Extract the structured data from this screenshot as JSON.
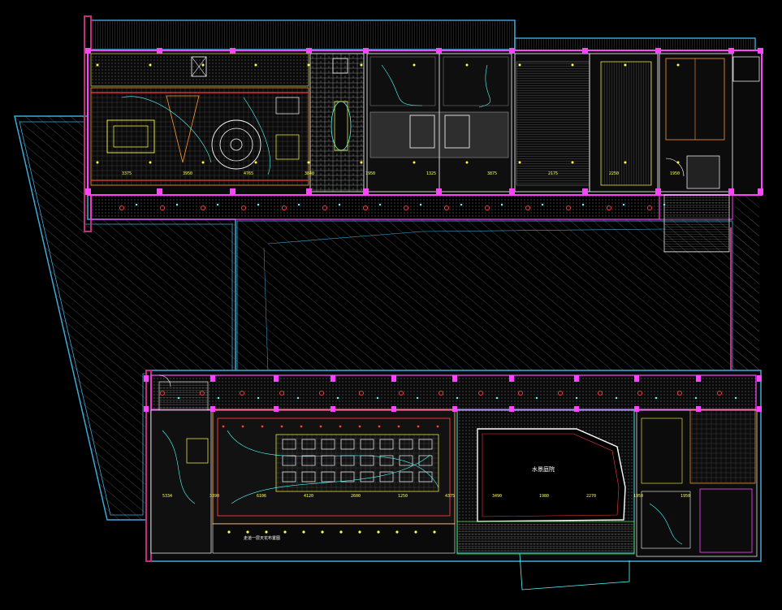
{
  "drawing": {
    "background": "#000000",
    "colors": {
      "facade": "#3fa9d9",
      "wall": "#ff44ff",
      "wall_dark": "#c0307a",
      "furniture": "#ffff44",
      "fixture": "#55ffff",
      "red": "#ff3b3b",
      "grid": "#5a5a5a",
      "white": "#ffffff",
      "green": "#44ff44",
      "orange": "#ff9a30"
    },
    "dimensions_upper": [
      "3375",
      "3950",
      "4765",
      "3840",
      "1950",
      "1325",
      "3875",
      "2175",
      "2250",
      "1950"
    ],
    "dimensions_lower": [
      "5334",
      "3390",
      "6106",
      "4120",
      "2600",
      "1250",
      "4375",
      "3490",
      "1980",
      "2270",
      "1950",
      "1950"
    ],
    "labels": {
      "pool_room": "水景庭院",
      "corridor_note": "走道一层天花布置图"
    }
  }
}
